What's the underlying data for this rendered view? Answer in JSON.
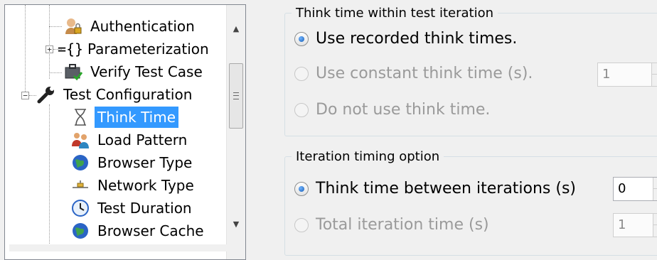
{
  "tree": {
    "items": [
      {
        "label": "Authentication",
        "icon": "user-lock-icon"
      },
      {
        "label": "Parameterization",
        "icon": "braces-icon"
      },
      {
        "label": "Verify Test Case",
        "icon": "briefcase-check-icon"
      },
      {
        "label": "Test Configuration",
        "icon": "wrench-icon"
      },
      {
        "label": "Think Time",
        "icon": "hourglass-icon"
      },
      {
        "label": "Load Pattern",
        "icon": "users-icon"
      },
      {
        "label": "Browser Type",
        "icon": "globe-icon"
      },
      {
        "label": "Network Type",
        "icon": "network-icon"
      },
      {
        "label": "Test Duration",
        "icon": "clock-icon"
      },
      {
        "label": "Browser Cache",
        "icon": "globe-icon"
      }
    ],
    "selected": "Think Time",
    "accent": "#3399ff"
  },
  "think_time_group": {
    "title": "Think time within test iteration",
    "options": [
      {
        "label": "Use recorded think times.",
        "checked": true,
        "enabled": true
      },
      {
        "label": "Use constant think time (s).",
        "checked": false,
        "enabled": false
      },
      {
        "label": "Do not use think time.",
        "checked": false,
        "enabled": false
      }
    ],
    "constant_value": "1"
  },
  "iteration_group": {
    "title": "Iteration timing option",
    "options": [
      {
        "label": "Think time between iterations (s)",
        "checked": true,
        "enabled": true
      },
      {
        "label": "Total iteration time (s)",
        "checked": false,
        "enabled": false
      }
    ],
    "between_value": "0",
    "total_value": "1"
  }
}
